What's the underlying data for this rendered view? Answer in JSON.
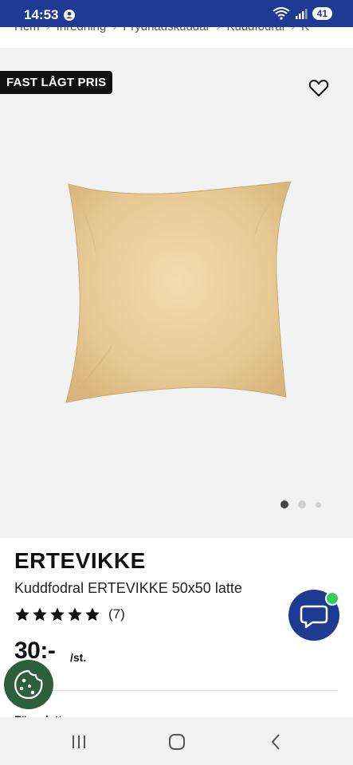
{
  "status_bar": {
    "time": "14:53",
    "battery": "41"
  },
  "breadcrumb": [
    "Hem",
    "Inredning",
    "Prydnadskuddar",
    "Kuddfodral",
    "K"
  ],
  "gallery": {
    "badge": "FAST LÅGT PRIS",
    "image_count": 3,
    "active_index": 0
  },
  "product": {
    "brand": "ERTEVIKKE",
    "subtitle": "Kuddfodral ERTEVIKKE 50x50 latte",
    "rating": 5,
    "rating_count": "(7)",
    "price": "30:-",
    "unit": "/st.",
    "partial_text": "Färg: latte"
  },
  "colors": {
    "status_bar": "#1f3a93",
    "chat": "#1f3a93",
    "cookie": "#2d5f3c",
    "badge": "#111111",
    "pillow": "#e7c996"
  }
}
